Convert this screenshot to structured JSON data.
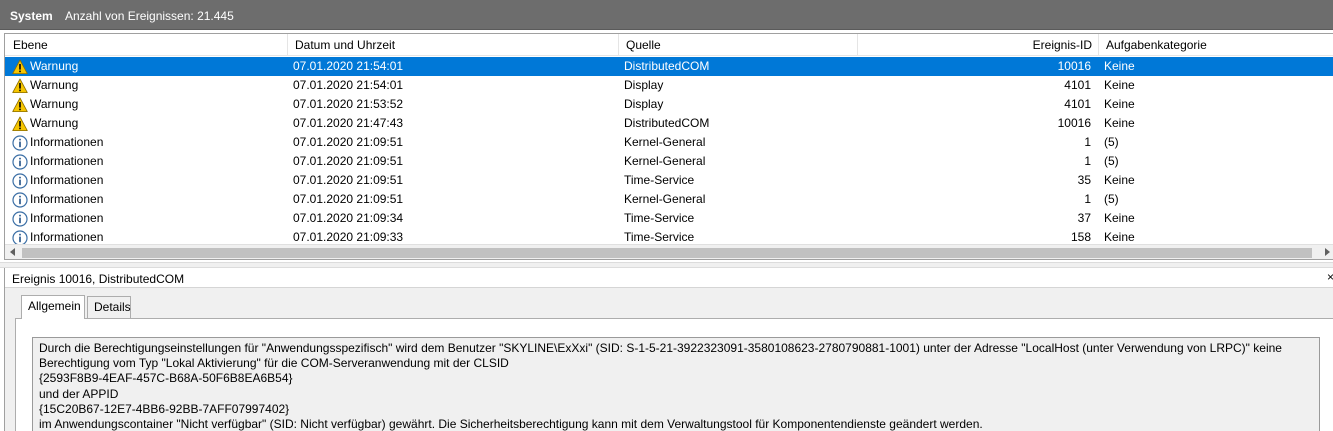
{
  "header": {
    "title": "System",
    "event_count": "Anzahl von Ereignissen: 21.445"
  },
  "columns": {
    "level": "Ebene",
    "date": "Datum und Uhrzeit",
    "source": "Quelle",
    "id": "Ereignis-ID",
    "category": "Aufgabenkategorie"
  },
  "events": [
    {
      "icon": "warning-icon",
      "level": "Warnung",
      "date": "07.01.2020 21:54:01",
      "source": "DistributedCOM",
      "id": "10016",
      "category": "Keine",
      "selected": true
    },
    {
      "icon": "warning-icon",
      "level": "Warnung",
      "date": "07.01.2020 21:54:01",
      "source": "Display",
      "id": "4101",
      "category": "Keine"
    },
    {
      "icon": "warning-icon",
      "level": "Warnung",
      "date": "07.01.2020 21:53:52",
      "source": "Display",
      "id": "4101",
      "category": "Keine"
    },
    {
      "icon": "warning-icon",
      "level": "Warnung",
      "date": "07.01.2020 21:47:43",
      "source": "DistributedCOM",
      "id": "10016",
      "category": "Keine"
    },
    {
      "icon": "info-icon",
      "level": "Informationen",
      "date": "07.01.2020 21:09:51",
      "source": "Kernel-General",
      "id": "1",
      "category": "(5)"
    },
    {
      "icon": "info-icon",
      "level": "Informationen",
      "date": "07.01.2020 21:09:51",
      "source": "Kernel-General",
      "id": "1",
      "category": "(5)"
    },
    {
      "icon": "info-icon",
      "level": "Informationen",
      "date": "07.01.2020 21:09:51",
      "source": "Time-Service",
      "id": "35",
      "category": "Keine"
    },
    {
      "icon": "info-icon",
      "level": "Informationen",
      "date": "07.01.2020 21:09:51",
      "source": "Kernel-General",
      "id": "1",
      "category": "(5)"
    },
    {
      "icon": "info-icon",
      "level": "Informationen",
      "date": "07.01.2020 21:09:34",
      "source": "Time-Service",
      "id": "37",
      "category": "Keine"
    },
    {
      "icon": "info-icon",
      "level": "Informationen",
      "date": "07.01.2020 21:09:33",
      "source": "Time-Service",
      "id": "158",
      "category": "Keine"
    }
  ],
  "detail": {
    "title": "Ereignis 10016, DistributedCOM",
    "close": "×",
    "tabs": [
      "Allgemein",
      "Details"
    ],
    "message_lines": [
      "Durch die Berechtigungseinstellungen für \"Anwendungsspezifisch\" wird dem Benutzer \"SKYLINE\\ExXxi\" (SID: S-1-5-21-3922323091-3580108623-2780790881-1001) unter der Adresse \"LocalHost (unter Verwendung von LRPC)\" keine",
      "Berechtigung vom Typ \"Lokal Aktivierung\" für die COM-Serveranwendung mit der CLSID",
      "{2593F8B9-4EAF-457C-B68A-50F6B8EA6B54}",
      " und der APPID",
      "{15C20B67-12E7-4BB6-92BB-7AFF07997402}",
      " im Anwendungscontainer \"Nicht verfügbar\" (SID: Nicht verfügbar) gewährt. Die Sicherheitsberechtigung kann mit dem Verwaltungstool für Komponentendienste geändert werden."
    ]
  },
  "colors": {
    "selection": "#0078d7",
    "titlebar": "#6d6d6d",
    "warning": "#f7c600",
    "info_blue": "#3a6ea5"
  }
}
